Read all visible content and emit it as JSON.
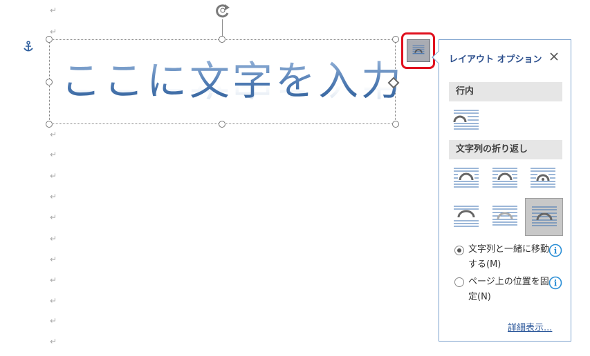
{
  "document": {
    "wordart_text": "ここに文字を入力",
    "paragraph_mark": "↵"
  },
  "layout_options": {
    "title": "レイアウト オプション",
    "close_label": "✕",
    "inline_section": "行内",
    "wrap_section": "文字列の折り返し",
    "move_with_text": "文字列と一緒に移動する(M)",
    "fix_position": "ページ上の位置を固定(N)",
    "details_link": "詳細表示...",
    "info_glyph": "i",
    "selected_option": "move_with_text"
  },
  "colors": {
    "highlight": "#e0101e",
    "panel_title": "#2b4e8c",
    "info": "#2b8fd6",
    "link": "#2b579a"
  },
  "icons": [
    "anchor-icon",
    "rotate-handle-icon",
    "layout-options-icon",
    "close-icon",
    "info-icon"
  ]
}
